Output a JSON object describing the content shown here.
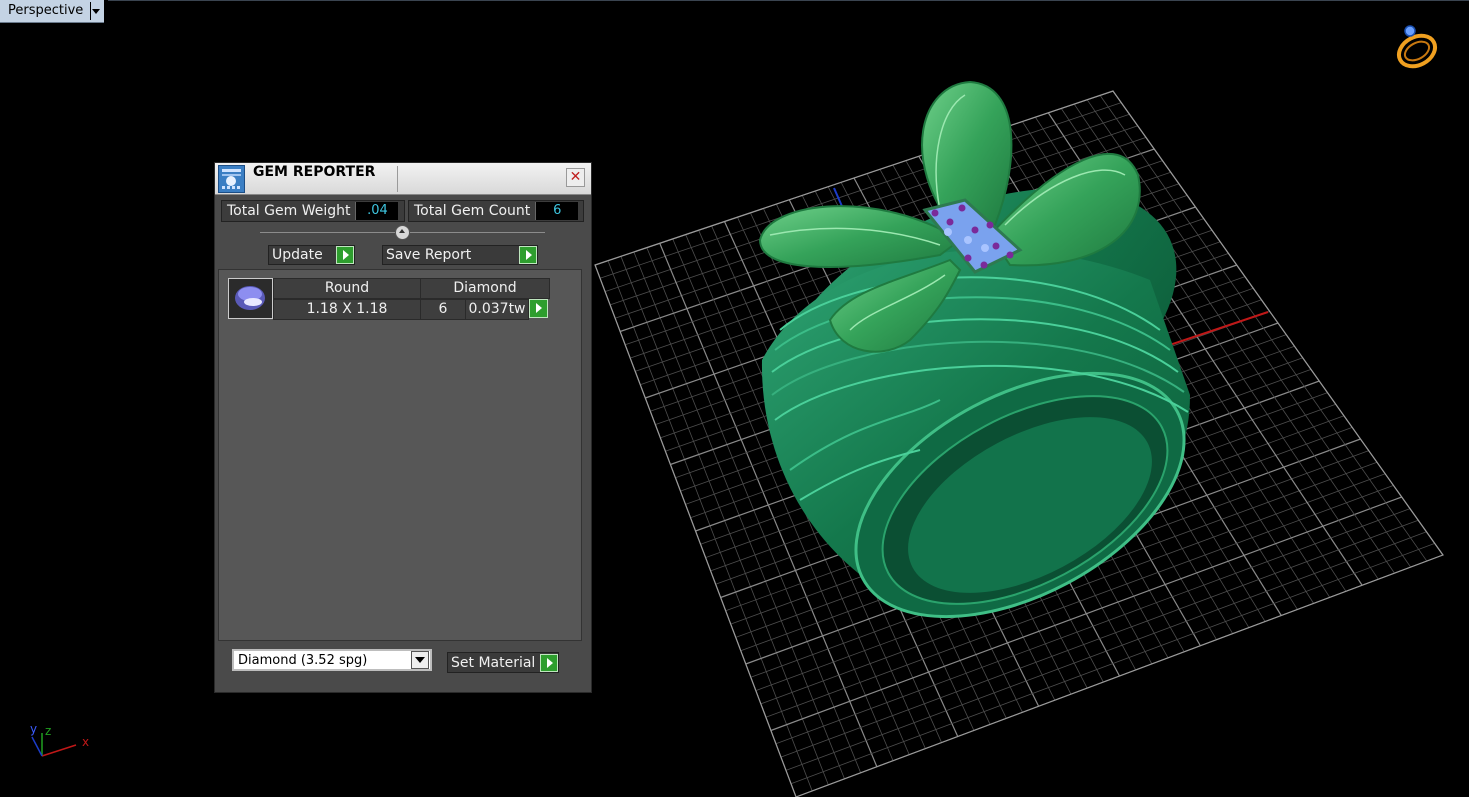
{
  "viewport": {
    "title": "Perspective"
  },
  "gem_reporter": {
    "title": "GEM REPORTER",
    "total_weight_label": "Total Gem Weight",
    "total_weight_value": ".04",
    "total_count_label": "Total Gem Count",
    "total_count_value": "6",
    "update_label": "Update",
    "save_report_label": "Save Report",
    "gems": [
      {
        "shape": "Round",
        "material": "Diamond",
        "size": "1.18 X 1.18",
        "count": "6",
        "weight": "0.037tw"
      }
    ],
    "material_select": "Diamond    (3.52 spg)",
    "set_material_label": "Set Material"
  },
  "axis_labels": {
    "x": "x",
    "y": "y",
    "z": "z"
  },
  "colors": {
    "ring_green": "#1e8a5c",
    "bow_green": "#3aa35a",
    "gem_blue": "#7aa2ee",
    "prong_purple": "#7a2a9a",
    "accent_cyan": "#3ec6e0"
  }
}
